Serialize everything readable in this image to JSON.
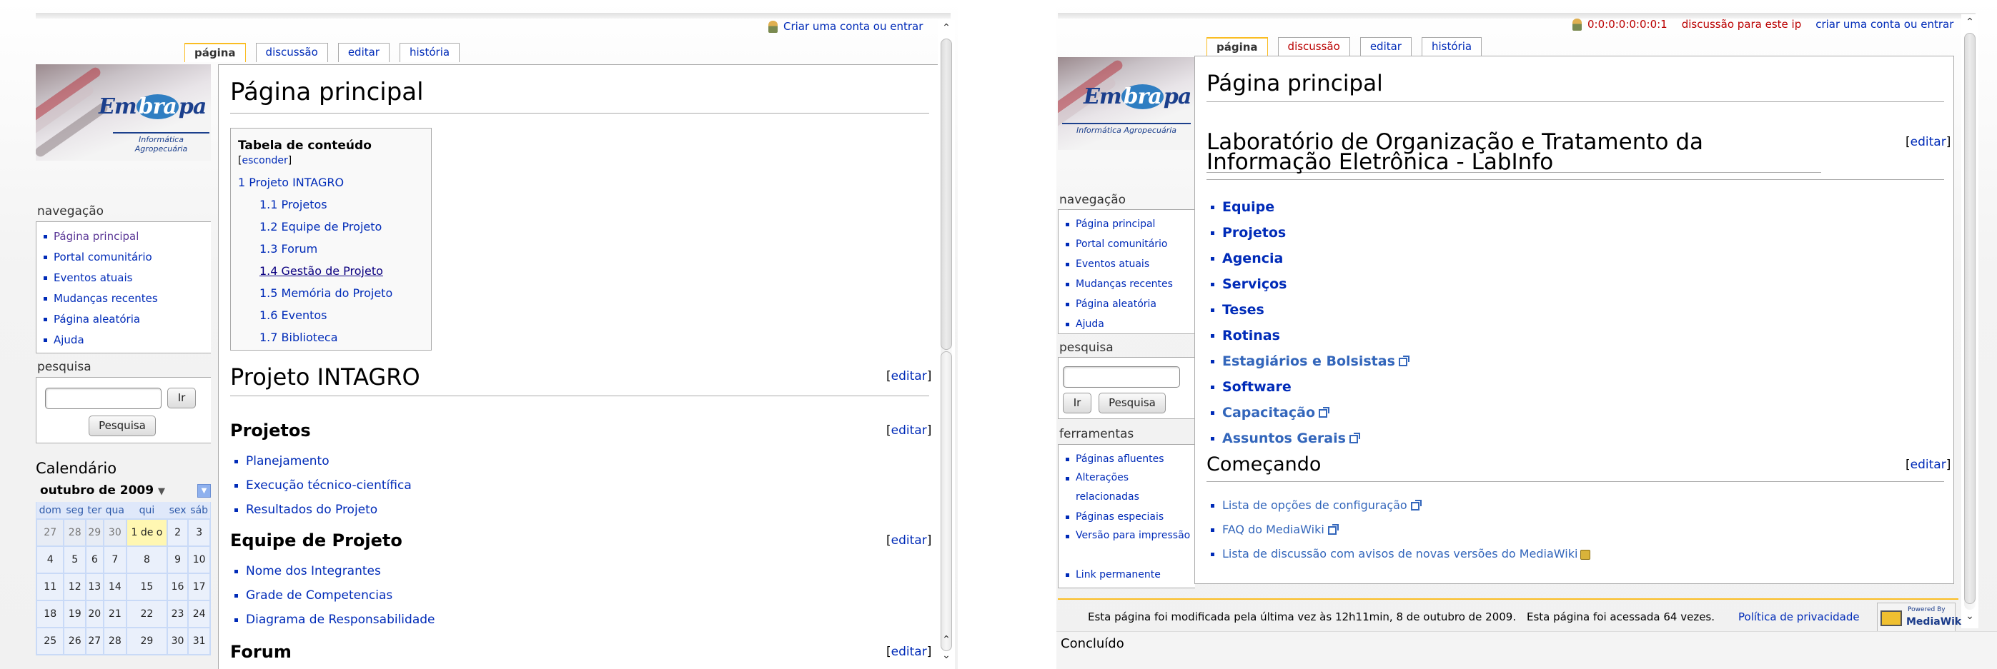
{
  "left": {
    "personal": {
      "create_account": "Criar uma conta ou entrar"
    },
    "tabs": [
      {
        "label": "página",
        "selected": true
      },
      {
        "label": "discussão"
      },
      {
        "label": "editar"
      },
      {
        "label": "história"
      }
    ],
    "logo": {
      "brand_pre": "Em",
      "brand_hl": "bra",
      "brand_post": "pa",
      "sub": "Informática Agropecuária"
    },
    "nav": {
      "title": "navegação",
      "items": [
        "Página principal",
        "Portal comunitário",
        "Eventos atuais",
        "Mudanças recentes",
        "Página aleatória",
        "Ajuda"
      ]
    },
    "search": {
      "title": "pesquisa",
      "go": "Ir",
      "search": "Pesquisa"
    },
    "calendar": {
      "title": "Calendário",
      "month": "outubro de 2009",
      "days": [
        "dom",
        "seg",
        "ter",
        "qua",
        "qui",
        "sex",
        "sáb"
      ],
      "weeks": [
        [
          "27",
          "28",
          "29",
          "30",
          "1 de o",
          "2",
          "3"
        ],
        [
          "4",
          "5",
          "6",
          "7",
          "8",
          "9",
          "10"
        ],
        [
          "11",
          "12",
          "13",
          "14",
          "15",
          "16",
          "17"
        ],
        [
          "18",
          "19",
          "20",
          "21",
          "22",
          "23",
          "24"
        ],
        [
          "25",
          "26",
          "27",
          "28",
          "29",
          "30",
          "31"
        ]
      ]
    },
    "content": {
      "heading": "Página principal",
      "toc": {
        "title": "Tabela de conteúdo",
        "hide": "esconder",
        "entries": [
          "1 Projeto INTAGRO",
          "1.1 Projetos",
          "1.2 Equipe de Projeto",
          "1.3 Forum",
          "1.4 Gestão de Projeto",
          "1.5 Memória do Projeto",
          "1.6 Eventos",
          "1.7 Biblioteca"
        ]
      },
      "edit": "editar",
      "h2_intagro": "Projeto INTAGRO",
      "h3_projetos": "Projetos",
      "projetos_items": [
        "Planejamento",
        "Execução técnico-científica",
        "Resultados do Projeto"
      ],
      "h3_equipe": "Equipe de Projeto",
      "equipe_items": [
        "Nome dos Integrantes",
        "Grade de Competencias",
        "Diagrama de Responsabilidade"
      ],
      "h3_forum": "Forum"
    }
  },
  "right": {
    "personal": {
      "ip": "0:0:0:0:0:0:0:1",
      "talk": "discussão para este ip",
      "create_account": "criar uma conta ou entrar"
    },
    "tabs": [
      {
        "label": "página",
        "selected": true
      },
      {
        "label": "discussão",
        "new": true
      },
      {
        "label": "editar"
      },
      {
        "label": "história"
      }
    ],
    "logo": {
      "brand_pre": "Em",
      "brand_hl": "bra",
      "brand_post": "pa",
      "sub": "Informática Agropecuária"
    },
    "nav": {
      "title": "navegação",
      "items": [
        "Página principal",
        "Portal comunitário",
        "Eventos atuais",
        "Mudanças recentes",
        "Página aleatória",
        "Ajuda"
      ]
    },
    "search": {
      "title": "pesquisa",
      "go": "Ir",
      "search": "Pesquisa"
    },
    "tools": {
      "title": "ferramentas",
      "items": [
        "Páginas afluentes",
        "Alterações relacionadas",
        "Páginas especiais",
        "Versão para impressão",
        "Link permanente"
      ]
    },
    "content": {
      "heading": "Página principal",
      "h2_lab": "Laboratório de Organização e Tratamento da Informação Eletrônica - LabInfo",
      "edit": "editar",
      "lab_items": [
        "Equipe",
        "Projetos",
        "Agencia",
        "Serviços",
        "Teses",
        "Rotinas"
      ],
      "lab_ext_items": [
        "Estagiários e Bolsistas",
        "Software",
        "Capacitação",
        "Assuntos Gerais"
      ],
      "h2_comecando": "Começando",
      "comecando_items": [
        "Lista de opções de configuração",
        "FAQ do MediaWiki",
        "Lista de discussão com avisos de novas versões do MediaWiki"
      ]
    },
    "footer": {
      "modified": "Esta página foi modificada pela última vez às 12h11min, 8 de outubro de 2009.",
      "accessed": "Esta página foi acessada 64 vezes.",
      "privacy": "Política de privacidade",
      "powered_small": "Powered By",
      "powered": "MediaWiki"
    },
    "status": "Concluído"
  }
}
